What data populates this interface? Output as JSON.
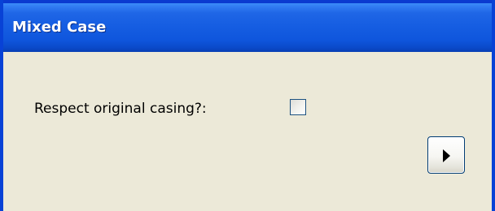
{
  "window": {
    "title": "Mixed Case"
  },
  "form": {
    "respect_casing_label": "Respect original casing?:",
    "respect_casing_checked": false
  },
  "actions": {
    "next_icon": "play-right-arrow-icon"
  },
  "colors": {
    "titlebar": "#0f56dd",
    "titlebar_text": "#ffffff",
    "window_background": "#ece9d8",
    "window_border": "#0842d6"
  }
}
